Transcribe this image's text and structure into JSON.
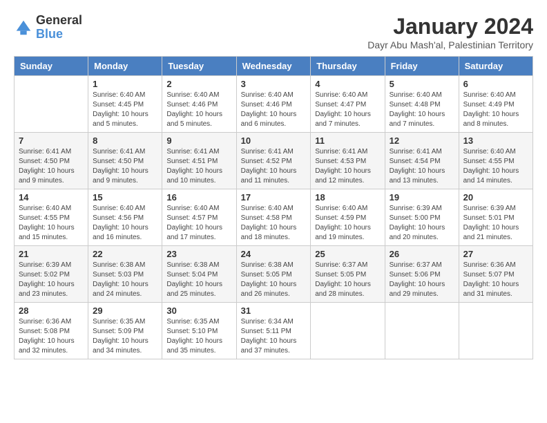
{
  "logo": {
    "general": "General",
    "blue": "Blue"
  },
  "header": {
    "month_title": "January 2024",
    "subtitle": "Dayr Abu Mash'al, Palestinian Territory"
  },
  "days_of_week": [
    "Sunday",
    "Monday",
    "Tuesday",
    "Wednesday",
    "Thursday",
    "Friday",
    "Saturday"
  ],
  "weeks": [
    [
      {
        "day": "",
        "sunrise": "",
        "sunset": "",
        "daylight": ""
      },
      {
        "day": "1",
        "sunrise": "Sunrise: 6:40 AM",
        "sunset": "Sunset: 4:45 PM",
        "daylight": "Daylight: 10 hours and 5 minutes."
      },
      {
        "day": "2",
        "sunrise": "Sunrise: 6:40 AM",
        "sunset": "Sunset: 4:46 PM",
        "daylight": "Daylight: 10 hours and 5 minutes."
      },
      {
        "day": "3",
        "sunrise": "Sunrise: 6:40 AM",
        "sunset": "Sunset: 4:46 PM",
        "daylight": "Daylight: 10 hours and 6 minutes."
      },
      {
        "day": "4",
        "sunrise": "Sunrise: 6:40 AM",
        "sunset": "Sunset: 4:47 PM",
        "daylight": "Daylight: 10 hours and 7 minutes."
      },
      {
        "day": "5",
        "sunrise": "Sunrise: 6:40 AM",
        "sunset": "Sunset: 4:48 PM",
        "daylight": "Daylight: 10 hours and 7 minutes."
      },
      {
        "day": "6",
        "sunrise": "Sunrise: 6:40 AM",
        "sunset": "Sunset: 4:49 PM",
        "daylight": "Daylight: 10 hours and 8 minutes."
      }
    ],
    [
      {
        "day": "7",
        "sunrise": "Sunrise: 6:41 AM",
        "sunset": "Sunset: 4:50 PM",
        "daylight": "Daylight: 10 hours and 9 minutes."
      },
      {
        "day": "8",
        "sunrise": "Sunrise: 6:41 AM",
        "sunset": "Sunset: 4:50 PM",
        "daylight": "Daylight: 10 hours and 9 minutes."
      },
      {
        "day": "9",
        "sunrise": "Sunrise: 6:41 AM",
        "sunset": "Sunset: 4:51 PM",
        "daylight": "Daylight: 10 hours and 10 minutes."
      },
      {
        "day": "10",
        "sunrise": "Sunrise: 6:41 AM",
        "sunset": "Sunset: 4:52 PM",
        "daylight": "Daylight: 10 hours and 11 minutes."
      },
      {
        "day": "11",
        "sunrise": "Sunrise: 6:41 AM",
        "sunset": "Sunset: 4:53 PM",
        "daylight": "Daylight: 10 hours and 12 minutes."
      },
      {
        "day": "12",
        "sunrise": "Sunrise: 6:41 AM",
        "sunset": "Sunset: 4:54 PM",
        "daylight": "Daylight: 10 hours and 13 minutes."
      },
      {
        "day": "13",
        "sunrise": "Sunrise: 6:40 AM",
        "sunset": "Sunset: 4:55 PM",
        "daylight": "Daylight: 10 hours and 14 minutes."
      }
    ],
    [
      {
        "day": "14",
        "sunrise": "Sunrise: 6:40 AM",
        "sunset": "Sunset: 4:55 PM",
        "daylight": "Daylight: 10 hours and 15 minutes."
      },
      {
        "day": "15",
        "sunrise": "Sunrise: 6:40 AM",
        "sunset": "Sunset: 4:56 PM",
        "daylight": "Daylight: 10 hours and 16 minutes."
      },
      {
        "day": "16",
        "sunrise": "Sunrise: 6:40 AM",
        "sunset": "Sunset: 4:57 PM",
        "daylight": "Daylight: 10 hours and 17 minutes."
      },
      {
        "day": "17",
        "sunrise": "Sunrise: 6:40 AM",
        "sunset": "Sunset: 4:58 PM",
        "daylight": "Daylight: 10 hours and 18 minutes."
      },
      {
        "day": "18",
        "sunrise": "Sunrise: 6:40 AM",
        "sunset": "Sunset: 4:59 PM",
        "daylight": "Daylight: 10 hours and 19 minutes."
      },
      {
        "day": "19",
        "sunrise": "Sunrise: 6:39 AM",
        "sunset": "Sunset: 5:00 PM",
        "daylight": "Daylight: 10 hours and 20 minutes."
      },
      {
        "day": "20",
        "sunrise": "Sunrise: 6:39 AM",
        "sunset": "Sunset: 5:01 PM",
        "daylight": "Daylight: 10 hours and 21 minutes."
      }
    ],
    [
      {
        "day": "21",
        "sunrise": "Sunrise: 6:39 AM",
        "sunset": "Sunset: 5:02 PM",
        "daylight": "Daylight: 10 hours and 23 minutes."
      },
      {
        "day": "22",
        "sunrise": "Sunrise: 6:38 AM",
        "sunset": "Sunset: 5:03 PM",
        "daylight": "Daylight: 10 hours and 24 minutes."
      },
      {
        "day": "23",
        "sunrise": "Sunrise: 6:38 AM",
        "sunset": "Sunset: 5:04 PM",
        "daylight": "Daylight: 10 hours and 25 minutes."
      },
      {
        "day": "24",
        "sunrise": "Sunrise: 6:38 AM",
        "sunset": "Sunset: 5:05 PM",
        "daylight": "Daylight: 10 hours and 26 minutes."
      },
      {
        "day": "25",
        "sunrise": "Sunrise: 6:37 AM",
        "sunset": "Sunset: 5:05 PM",
        "daylight": "Daylight: 10 hours and 28 minutes."
      },
      {
        "day": "26",
        "sunrise": "Sunrise: 6:37 AM",
        "sunset": "Sunset: 5:06 PM",
        "daylight": "Daylight: 10 hours and 29 minutes."
      },
      {
        "day": "27",
        "sunrise": "Sunrise: 6:36 AM",
        "sunset": "Sunset: 5:07 PM",
        "daylight": "Daylight: 10 hours and 31 minutes."
      }
    ],
    [
      {
        "day": "28",
        "sunrise": "Sunrise: 6:36 AM",
        "sunset": "Sunset: 5:08 PM",
        "daylight": "Daylight: 10 hours and 32 minutes."
      },
      {
        "day": "29",
        "sunrise": "Sunrise: 6:35 AM",
        "sunset": "Sunset: 5:09 PM",
        "daylight": "Daylight: 10 hours and 34 minutes."
      },
      {
        "day": "30",
        "sunrise": "Sunrise: 6:35 AM",
        "sunset": "Sunset: 5:10 PM",
        "daylight": "Daylight: 10 hours and 35 minutes."
      },
      {
        "day": "31",
        "sunrise": "Sunrise: 6:34 AM",
        "sunset": "Sunset: 5:11 PM",
        "daylight": "Daylight: 10 hours and 37 minutes."
      },
      {
        "day": "",
        "sunrise": "",
        "sunset": "",
        "daylight": ""
      },
      {
        "day": "",
        "sunrise": "",
        "sunset": "",
        "daylight": ""
      },
      {
        "day": "",
        "sunrise": "",
        "sunset": "",
        "daylight": ""
      }
    ]
  ]
}
